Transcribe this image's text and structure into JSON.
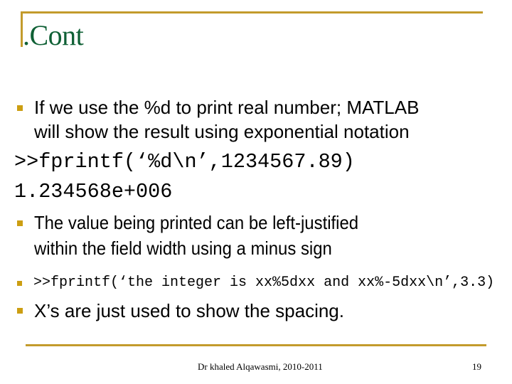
{
  "slide": {
    "title": ".Cont",
    "accent_color": "#C39B2C",
    "title_color": "#0F6035",
    "bullets": [
      {
        "lines": [
          "If we use the %d to print real number; MATLAB",
          "will show the result using exponential notation"
        ]
      },
      {
        "lines": [
          "The value being printed can be left-justified",
          "within the field width using a minus sign"
        ]
      },
      {
        "code": ">>fprintf(‘the integer is xx%5dxx and xx%-5dxx\\n’,3.3)"
      },
      {
        "lines": [
          "X’s are just used to show the spacing."
        ]
      }
    ],
    "code_block": {
      "command": ">>fprintf(‘%d\\n’,1234567.89)",
      "output": "1.234568e+006"
    },
    "footer": {
      "author": "Dr khaled Alqawasmi, 2010-2011",
      "page_number": "19"
    }
  }
}
